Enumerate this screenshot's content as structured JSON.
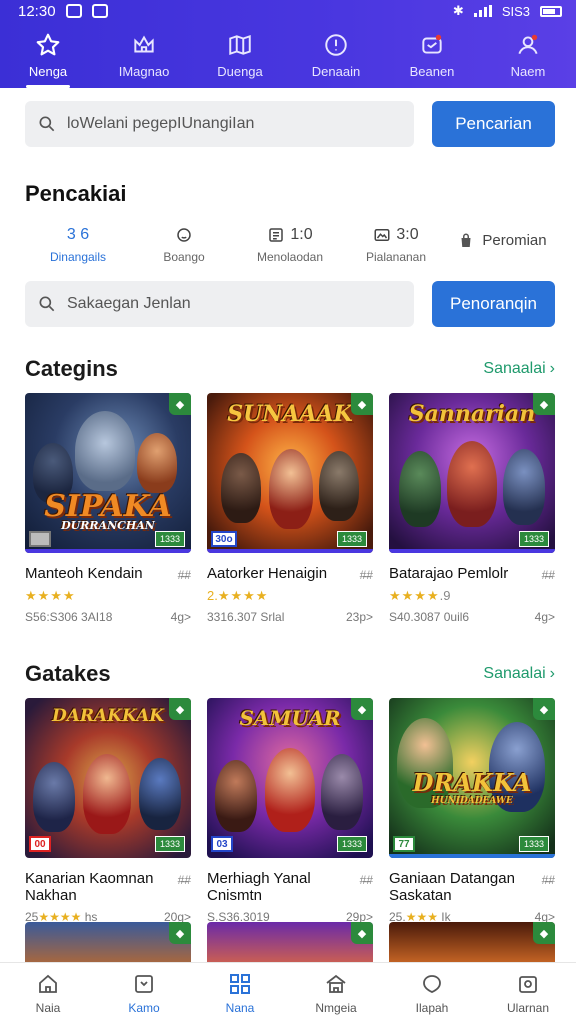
{
  "status": {
    "time": "12:30",
    "right": "SIS3"
  },
  "topnav": [
    {
      "label": "Nenga",
      "icon": "star-icon"
    },
    {
      "label": "IMagnao",
      "icon": "crown-icon"
    },
    {
      "label": "Duenga",
      "icon": "map-icon"
    },
    {
      "label": "Denaain",
      "icon": "alert-icon"
    },
    {
      "label": "Beanen",
      "icon": "notification-icon"
    },
    {
      "label": "Naem",
      "icon": "user-icon"
    }
  ],
  "search1": {
    "placeholder": "loWelani pegepIUnangiIan",
    "button": "Pencarian"
  },
  "heading": "Pencakiai",
  "filters": [
    {
      "value": "3 6",
      "label": "Dinangails",
      "icon": ""
    },
    {
      "value": "",
      "label": "Boango",
      "icon": "face-icon"
    },
    {
      "value": "1:0",
      "label": "Menolaodan",
      "icon": "list-icon"
    },
    {
      "value": "3:0",
      "label": "Pialananan",
      "icon": "image-icon"
    },
    {
      "value": "Peromian",
      "label": "",
      "icon": "bag-icon"
    }
  ],
  "search2": {
    "placeholder": "Sakaegan Jenlan",
    "button": "Penoranqin"
  },
  "sections": [
    {
      "title": "Categins",
      "more": "Sanaalai",
      "cards": [
        {
          "logo": "SIPAKA",
          "sublogo": "DURRANCHAN",
          "tag": "",
          "name": "Manteoh Kendain",
          "name2": "",
          "stars": "★★★★",
          "rating": "",
          "meta": "S56:S306 3AI18",
          "count": "4g>"
        },
        {
          "logo": "SUNAAAK",
          "sublogo": "",
          "tag": "30o",
          "name": "Aatorker Henaigin",
          "name2": "",
          "stars": "★★★★",
          "rating": "2.",
          "meta": "3316.307 Srlal",
          "count": "23p>"
        },
        {
          "logo": "Sannarian",
          "sublogo": "",
          "tag": "",
          "name": "Batarajao Pemlolr",
          "name2": "",
          "stars": "★★★★",
          "rating": ".9",
          "meta": "S40.3087 0uil6",
          "count": "4g>"
        }
      ]
    },
    {
      "title": "Gatakes",
      "more": "Sanaalai",
      "cards": [
        {
          "logo": "DARAKKAK",
          "sublogo": "",
          "tag": "00",
          "name": "Kanarian Kaomnan",
          "name2": "Nakhan",
          "stars": "★★★★",
          "rating": "25",
          "meta": "",
          "count": "20g>"
        },
        {
          "logo": "SAMUAR",
          "sublogo": "",
          "tag": "03",
          "name": "Merhiagh Yanal",
          "name2": "Cnismtn",
          "stars": "",
          "rating": "",
          "meta": "S.S36.3019",
          "count": "29p>"
        },
        {
          "logo": "DRAKKA",
          "sublogo": "HUNIDADEAWE",
          "tag": "77",
          "name": "Ganiaan Datangan",
          "name2": "Saskatan",
          "stars": "★★★",
          "rating": "25.",
          "meta": "",
          "count": "4g>"
        }
      ]
    }
  ],
  "bottom": [
    {
      "label": "Naia",
      "icon": "home-icon"
    },
    {
      "label": "Kamo",
      "icon": "card-icon"
    },
    {
      "label": "Nana",
      "icon": "grid-icon"
    },
    {
      "label": "Nmgeia",
      "icon": "house-icon"
    },
    {
      "label": "Ilapah",
      "icon": "circle-icon"
    },
    {
      "label": "Ularnan",
      "icon": "camera-icon"
    }
  ]
}
